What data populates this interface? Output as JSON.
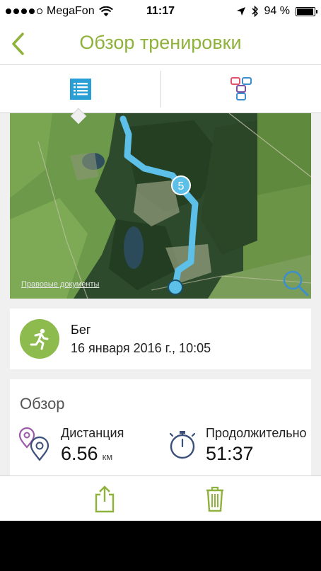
{
  "status_bar": {
    "carrier": "MegaFon",
    "time": "11:17",
    "battery": "94 %",
    "battery_level": 0.94,
    "signal_bars_filled": 4,
    "signal_bars_total": 5
  },
  "nav": {
    "title": "Обзор тренировки",
    "back_icon": "chevron-left-icon"
  },
  "tabs": [
    {
      "icon": "list-icon",
      "selected": true
    },
    {
      "icon": "splits-icon",
      "selected": false
    }
  ],
  "map": {
    "legal_link": "Правовые документы",
    "marker_label": "5",
    "search_icon": "magnifier-icon"
  },
  "activity": {
    "name": "Бег",
    "date": "16 января 2016 г., 10:05",
    "icon": "running-icon"
  },
  "overview": {
    "title": "Обзор",
    "distance": {
      "label": "Дистанция",
      "value": "6.56",
      "unit": "км",
      "icon": "location-pins-icon"
    },
    "duration": {
      "label": "Продолжительно",
      "value": "51:37",
      "icon": "stopwatch-icon"
    }
  },
  "toolbar": {
    "share_icon": "share-icon",
    "delete_icon": "trash-icon"
  },
  "colors": {
    "accent_green": "#8fb23a",
    "tab_blue": "#2a9fd6",
    "route_blue": "#5cc0e8",
    "activity_green": "#8dbb4e",
    "icon_purple": "#9b5aa8",
    "icon_navy": "#3a4f7a"
  }
}
